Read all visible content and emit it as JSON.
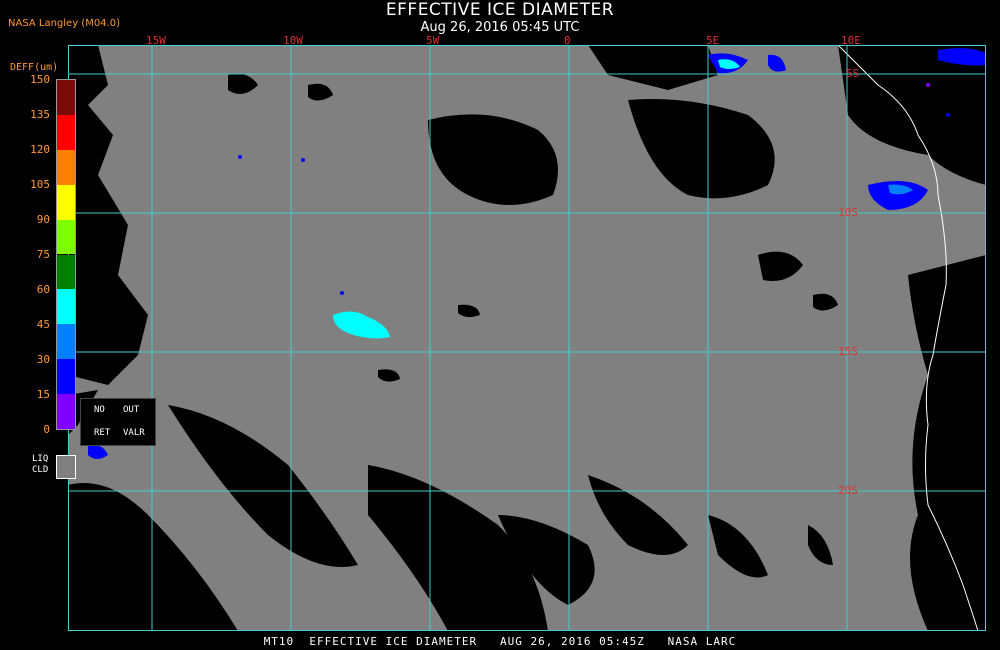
{
  "title": "EFFECTIVE ICE DIAMETER",
  "subtitle": "Aug 26, 2016 05:45 UTC",
  "agency": "NASA Langley (M04.0)",
  "footer": "MT10  EFFECTIVE ICE DIAMETER   AUG 26, 2016 05:45Z   NASA LARC",
  "legend": {
    "title": "DEFF(um)",
    "ticks": [
      "150",
      "135",
      "120",
      "105",
      "90",
      "75",
      "60",
      "45",
      "30",
      "15",
      "0"
    ],
    "colors": [
      "#7a0a0a",
      "#ff0000",
      "#ff8000",
      "#ffff00",
      "#80ff00",
      "#008000",
      "#00ffff",
      "#0080ff",
      "#0000ff",
      "#8000ff"
    ],
    "no_ret": [
      "NO",
      "RET"
    ],
    "out_valr": [
      "OUT",
      "VALR"
    ],
    "liq_cld": [
      "LIQ",
      "CLD"
    ],
    "liq_color": "#808080"
  },
  "map": {
    "lon_labels": [
      "15W",
      "10W",
      "5W",
      "0",
      "5E",
      "10E"
    ],
    "lat_labels": [
      "5S",
      "10S",
      "15S",
      "20S"
    ],
    "grid_color": "#40d0d0",
    "cloud_color": "#808080",
    "clear_color": "#000000",
    "coast_color": "#ffffff"
  }
}
